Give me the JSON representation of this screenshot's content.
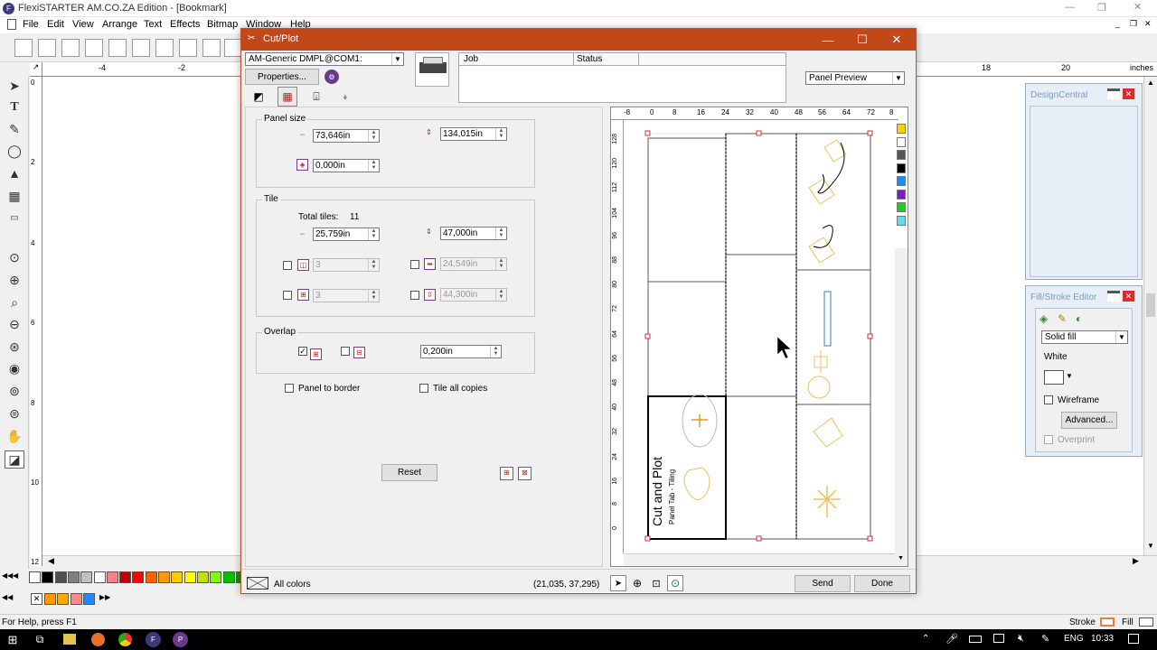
{
  "app": {
    "title": "FlexiSTARTER AM.CO.ZA Edition - [Bookmark]",
    "menu": [
      "File",
      "Edit",
      "View",
      "Arrange",
      "Text",
      "Effects",
      "Bitmap",
      "Window",
      "Help"
    ],
    "ruler_top_ticks": [
      "-4",
      "-2",
      "18",
      "20",
      "inches"
    ],
    "ruler_left_ticks": [
      "0",
      "2",
      "4",
      "6",
      "8",
      "10",
      "12"
    ],
    "status_help": "For Help, press F1",
    "stroke_label": "Stroke",
    "fill_label": "Fill"
  },
  "palette_colors": [
    "#ffffff",
    "#000000",
    "#505050",
    "#808080",
    "#c0c0c0",
    "#ffffff",
    "#ff8080",
    "#c00000",
    "#ff0000",
    "#ff6000",
    "#ff9900",
    "#ffcc00",
    "#ffff00",
    "#c0e000",
    "#80ff00",
    "#00c000",
    "#00a000",
    "#00e040",
    "#00c0c0"
  ],
  "palette2_colors": [
    "#ff9900",
    "#ffaa00",
    "#ff8888",
    "#2288ff"
  ],
  "design_central": {
    "title": "DesignCentral"
  },
  "fill_stroke_editor": {
    "title": "Fill/Stroke Editor",
    "fill_type": "Solid fill",
    "color_name": "White",
    "wireframe_label": "Wireframe",
    "advanced_label": "Advanced...",
    "overprint_label": "Overprint"
  },
  "dialog": {
    "title": "Cut/Plot",
    "device": "AM-Generic DMPL@COM1:",
    "properties_label": "Properties...",
    "job_columns": [
      "Job",
      "Status"
    ],
    "preview_mode": "Panel Preview",
    "panel_size": {
      "label": "Panel size",
      "width": "73,646in",
      "height": "134,015in",
      "third": "0,000in"
    },
    "tile": {
      "label": "Tile",
      "total_tiles_label": "Total tiles:",
      "total_tiles": "11",
      "width": "25,759in",
      "height": "47,000in",
      "cols": "3",
      "col_size": "24,549in",
      "rows": "3",
      "row_size": "44,300in"
    },
    "overlap": {
      "label": "Overlap",
      "value": "0,200in"
    },
    "panel_to_border_label": "Panel to border",
    "tile_all_copies_label": "Tile all copies",
    "reset_label": "Reset",
    "all_colors_label": "All colors",
    "coordinates": "(21,035, 37,295)",
    "send_label": "Send",
    "done_label": "Done",
    "preview_ruler_top": [
      "-8",
      "0",
      "8",
      "16",
      "24",
      "32",
      "40",
      "48",
      "56",
      "64",
      "72",
      "8"
    ],
    "preview_ruler_left": [
      "128",
      "120",
      "112",
      "104",
      "96",
      "88",
      "80",
      "72",
      "64",
      "56",
      "48",
      "40",
      "32",
      "24",
      "16",
      "8",
      "0"
    ],
    "preview_text_main": "Cut and Plot",
    "preview_text_sub": "Panel Tab - Tiling",
    "color_bar": [
      "#ffd000",
      "#ffffff",
      "#555555",
      "#000000",
      "#1e88ff",
      "#7a1adc",
      "#22cc22",
      "#66ddee"
    ]
  },
  "taskbar": {
    "lang": "ENG",
    "time": "10:33"
  }
}
